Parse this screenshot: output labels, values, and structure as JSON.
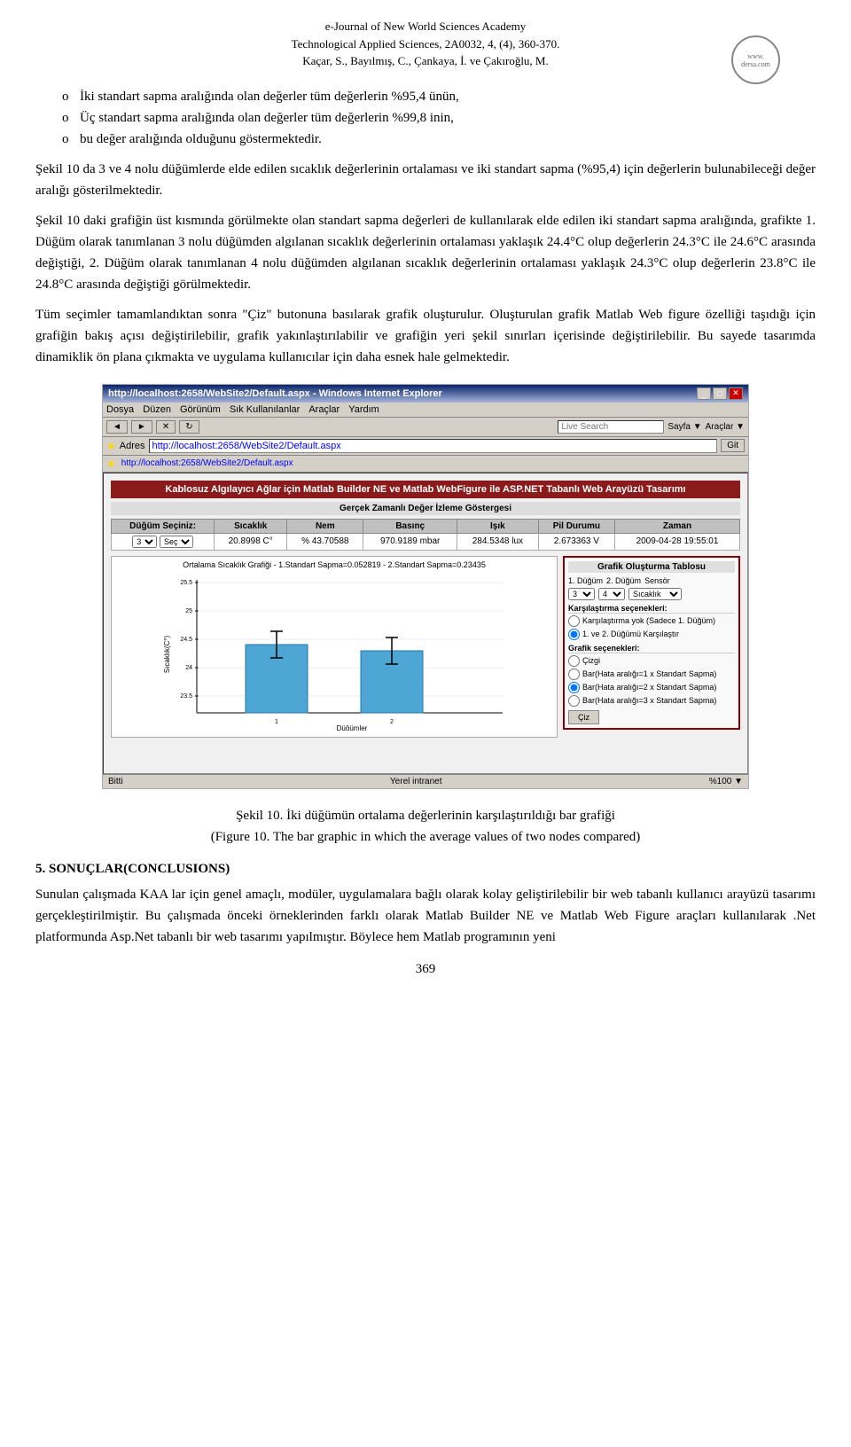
{
  "header": {
    "line1": "e-Journal of New World Sciences Academy",
    "line2": "Technological Applied Sciences, 2A0032, 4, (4), 360-370.",
    "line3": "Kaçar, S., Bayılmış, C., Çankaya, İ. ve Çakıroğlu, M."
  },
  "bullets": [
    "İki standart sapma aralığında olan değerler tüm değerlerin %95,4 ünün,",
    "Üç standart sapma aralığında olan değerler tüm değerlerin %99,8 inin,",
    "bu değer aralığında olduğunu göstermektedir."
  ],
  "para1": "Şekil 10 da 3 ve 4 nolu düğümlerde elde edilen sıcaklık değerlerinin ortalaması ve iki standart sapma (%95,4) için değerlerin bulunabileceği değer aralığı gösterilmektedir.",
  "para2": "Şekil 10 daki grafiğin üst kısmında görülmekte olan standart sapma değerleri de kullanılarak elde edilen iki standart sapma aralığında, grafikte 1.",
  "para3": "Düğüm olarak tanımlanan 3 nolu düğümden algılanan sıcaklık değerlerinin ortalaması yaklaşık 24.4°C olup değerlerin 24.3°C ile 24.6°C arasında değiştiği, 2.",
  "para4": "Düğüm olarak tanımlanan 4 nolu düğümden algılanan sıcaklık değerlerinin ortalaması yaklaşık 24.3°C olup değerlerin 23.8°C ile 24.8°C arasında değiştiği görülmektedir.",
  "para5": "Tüm seçimler tamamlandıktan sonra \"Çiz\" butonuna basılarak grafik oluşturulur. Oluşturulan grafik Matlab Web figure özelliği taşıdığı için grafiğin bakış açısı değiştirilebilir, grafik yakınlaştırılabilir ve grafiğin yeri şekil sınırları içerisinde değiştirilebilir. Bu sayede tasarımda dinamiklik ön plana çıkmakta ve uygulama kullanıcılar için daha esnek hale gelmektedir.",
  "screenshot": {
    "title": "http://localhost:2658/WebSite2/Default.aspx - Windows Internet Explorer",
    "address": "http://localhost:2658/WebSite2/Default.aspx",
    "address2": "http://localhost:2658/WebSite2/Default.aspx",
    "menu_items": [
      "Dosya",
      "Düzen",
      "Görünüm",
      "Sık Kullanılanlar",
      "Araçlar",
      "Yardım"
    ],
    "nav_btns": [
      "◄",
      "►",
      "✕",
      "↻"
    ],
    "page_title": "Kablosuz Algılayıcı Ağlar için Matlab Builder NE ve Matlab WebFigure ile ASP.NET Tabanlı Web Arayüzü Tasarımı",
    "page_subtitle": "Gerçek Zamanlı Değer İzleme Göstergesi",
    "table_headers": [
      "Düğüm Seçiniz:",
      "Sıcaklık",
      "Nem",
      "Basınç",
      "Işık",
      "Pil Durumu",
      "Zaman"
    ],
    "table_values": [
      "3",
      "20.8998 C°",
      "% 43.70588",
      "970.9189 mbar",
      "284.5348 lux",
      "2.673363 V",
      "2009-04-28 19:55:01"
    ],
    "graph_label": "Ortalama Sıcaklık Grafiği - 1.Standart Sapma=0.052819 - 2.Standart Sapma=0.23435",
    "x_label": "Düğümler",
    "y_label": "Sıcaklık(C°)",
    "control_title": "Grafik Oluşturma Tablosu",
    "node1_label": "1. Düğüm",
    "node2_label": "2. Düğüm",
    "sensor_label": "Sensör",
    "node1_val": "3",
    "node2_val": "4",
    "sensor_val": "Sıcaklık ▼",
    "compare_label": "Karşılaştırma seçenekleri:",
    "compare_opt1": "Karşılaştırma yok (Sadece 1. Düğüm)",
    "compare_opt2": "1. ve 2. Düğümü Karşılaştır",
    "graph_options_label": "Grafik seçenekleri:",
    "graph_opt1": "Çizgi",
    "graph_opt2": "Bar(Hata aralığı=1 x Standart Sapma)",
    "graph_opt3": "Bar(Hata aralığı=2 x Standart Sapma)",
    "graph_opt4": "Bar(Hata aralığı=3 x Standart Sapma)",
    "ciz_btn": "Çiz",
    "statusbar_left": "Bitti",
    "statusbar_right": "Yerel intranet",
    "statusbar_zoom": "%100 ▼",
    "fav_label": "http://localhost:2658/WebSite2/Default.aspx",
    "goto_label": "Git",
    "search_placeholder": "Live Search",
    "sayfa_label": "Sayfa ▼",
    "araclar_label": "Araçlar ▼"
  },
  "figure_caption": {
    "tr": "Şekil 10. İki düğümün ortalama değerlerinin karşılaştırıldığı bar grafiği",
    "en": "(Figure 10. The bar graphic in which the average values of two nodes compared)"
  },
  "section5": {
    "heading": "5. SONUÇLAR(CONCLUSIONS)",
    "text": "Sunulan çalışmada KAA lar için genel amaçlı, modüler, uygulamalara bağlı olarak kolay geliştirilebilir bir web tabanlı kullanıcı arayüzü tasarımı gerçekleştirilmiştir. Bu çalışmada önceki örneklerinden farklı olarak Matlab Builder NE ve Matlab Web Figure araçları kullanılarak .Net platformunda Asp.Net tabanlı bir web tasarımı yapılmıştır. Böylece hem Matlab programının yeni"
  },
  "page_number": "369"
}
